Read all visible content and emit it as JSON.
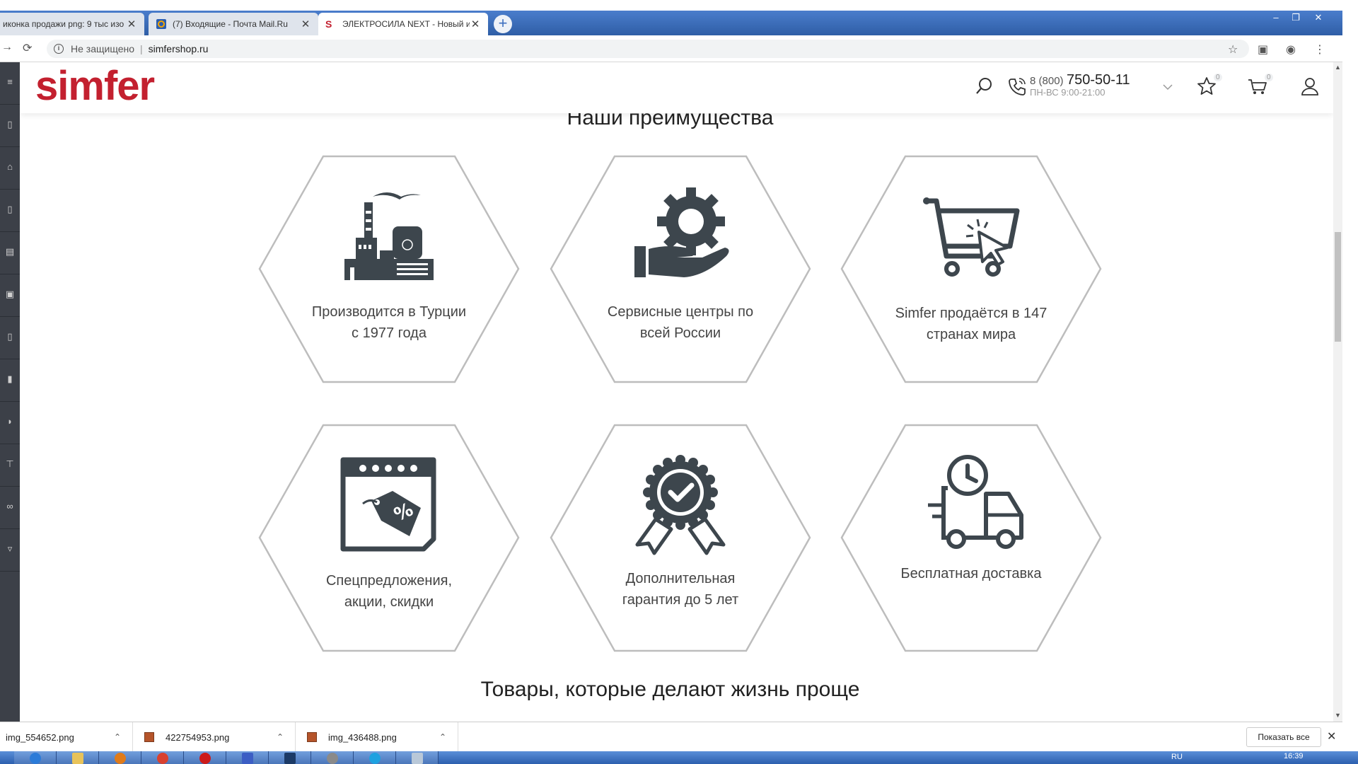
{
  "browser": {
    "tabs": [
      {
        "title": "иконка продажи png: 9 тыс изо",
        "active": false
      },
      {
        "title": "(7) Входящие - Почта Mail.Ru",
        "active": false
      },
      {
        "title": "ЭЛЕКТРОСИЛА NEXT - Новый и",
        "active": true
      }
    ],
    "new_tab_label": "+",
    "window_buttons": [
      "–",
      "❐",
      "✕"
    ],
    "security_label": "Не защищено",
    "url": "simfershop.ru",
    "accent_color": "#3d6fbf"
  },
  "site": {
    "logo": "simfer",
    "brand_color": "#c3202f",
    "phone_prefix": "8 (800)",
    "phone_number": "750-50-11",
    "phone_hours": "ПН-ВС 9:00-21:00",
    "favorites_count": "0",
    "cart_count": "0"
  },
  "advantages": {
    "title": "Наши преимущества",
    "items": [
      {
        "icon": "factory-icon",
        "line1": "Производится в Турции",
        "line2": "с 1977 года"
      },
      {
        "icon": "gear-hand-icon",
        "line1": "Сервисные центры по",
        "line2": "всей России"
      },
      {
        "icon": "cart-cursor-icon",
        "line1": "Simfer продаётся в 147",
        "line2": "странах мира"
      },
      {
        "icon": "calendar-discount-icon",
        "line1": "Спецпредложения,",
        "line2": "акции, скидки"
      },
      {
        "icon": "award-check-icon",
        "line1": "Дополнительная",
        "line2": "гарантия до 5 лет"
      },
      {
        "icon": "delivery-truck-icon",
        "line1": "Бесплатная доставка",
        "line2": ""
      }
    ]
  },
  "products_title": "Товары, которые делают жизнь проще",
  "downloads": {
    "items": [
      {
        "name": "img_554652.png"
      },
      {
        "name": "422754953.png"
      },
      {
        "name": "img_436488.png"
      }
    ],
    "show_all": "Показать все"
  },
  "taskbar": {
    "language": "RU",
    "clock": "16:39"
  }
}
